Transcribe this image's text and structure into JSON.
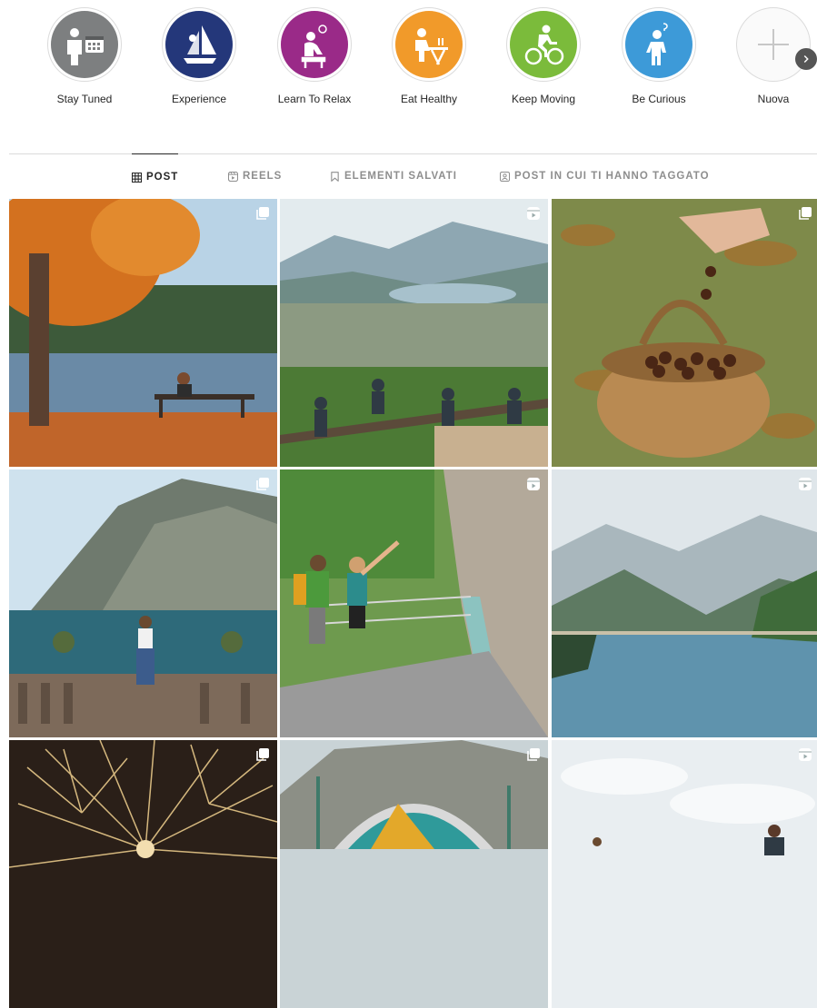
{
  "highlights": [
    {
      "label": "Stay Tuned",
      "color": "#7d7f80",
      "icon": "person-calendar-icon"
    },
    {
      "label": "Experience",
      "color": "#24377a",
      "icon": "sailing-icon"
    },
    {
      "label": "Learn To Relax",
      "color": "#9a2a88",
      "icon": "relax-icon"
    },
    {
      "label": "Eat Healthy",
      "color": "#f19a2a",
      "icon": "dining-icon"
    },
    {
      "label": "Keep Moving",
      "color": "#7bbb3b",
      "icon": "cyclist-icon"
    },
    {
      "label": "Be Curious",
      "color": "#3d9ad8",
      "icon": "curious-icon"
    },
    {
      "label": "Nuova",
      "color": "#fafafa",
      "icon": "plus-icon"
    }
  ],
  "tabs": [
    {
      "label": "POST",
      "icon": "grid-icon",
      "active": true
    },
    {
      "label": "REELS",
      "icon": "reels-icon",
      "active": false
    },
    {
      "label": "ELEMENTI SALVATI",
      "icon": "bookmark-icon",
      "active": false
    },
    {
      "label": "POST IN CUI TI HANNO TAGGATO",
      "icon": "tagged-icon",
      "active": false
    }
  ],
  "posts": [
    {
      "type": "carousel",
      "scene": "autumn-tree-bench-lake"
    },
    {
      "type": "reel",
      "scene": "valley-lake-hikers"
    },
    {
      "type": "carousel",
      "scene": "chestnut-basket"
    },
    {
      "type": "carousel",
      "scene": "lake-balustrade-woman"
    },
    {
      "type": "reel",
      "scene": "gorge-walkway-hikers"
    },
    {
      "type": "reel",
      "scene": "mountain-lake"
    },
    {
      "type": "carousel",
      "scene": "fireworks"
    },
    {
      "type": "carousel",
      "scene": "climbing-structure"
    },
    {
      "type": "reel",
      "scene": "hikers-sky"
    }
  ]
}
